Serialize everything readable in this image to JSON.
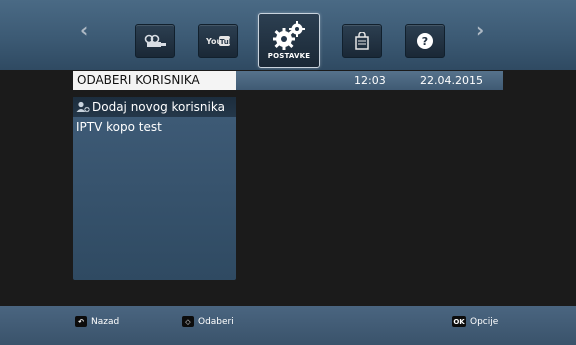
{
  "nav": {
    "items": [
      {
        "icon": "vod-icon",
        "label": ""
      },
      {
        "icon": "youtube-icon",
        "label": "You Tube"
      },
      {
        "icon": "settings-gears-icon",
        "label": "POSTAVKE",
        "active": true
      },
      {
        "icon": "shopping-bag-icon",
        "label": ""
      },
      {
        "icon": "help-icon",
        "label": "?"
      }
    ],
    "prev_arrow": "‹",
    "next_arrow": "›"
  },
  "header": {
    "title": "ODABERI KORISNIKA",
    "time": "12:03",
    "date": "22.04.2015"
  },
  "users": {
    "items": [
      {
        "label": "Dodaj novog korisnika",
        "icon": "add-user-icon",
        "selected": true
      },
      {
        "label": "IPTV kopo test",
        "selected": false
      }
    ]
  },
  "footer": {
    "back": {
      "key": "↶",
      "label": "Nazad"
    },
    "select": {
      "key": "◇",
      "label": "Odaberi"
    },
    "options": {
      "key": "OK",
      "label": "Opcije"
    }
  },
  "colors": {
    "bar": "#3c5a74",
    "panel": "#3f5c78",
    "background": "#1b1b1b",
    "selected_row": "#1c2d3d"
  }
}
